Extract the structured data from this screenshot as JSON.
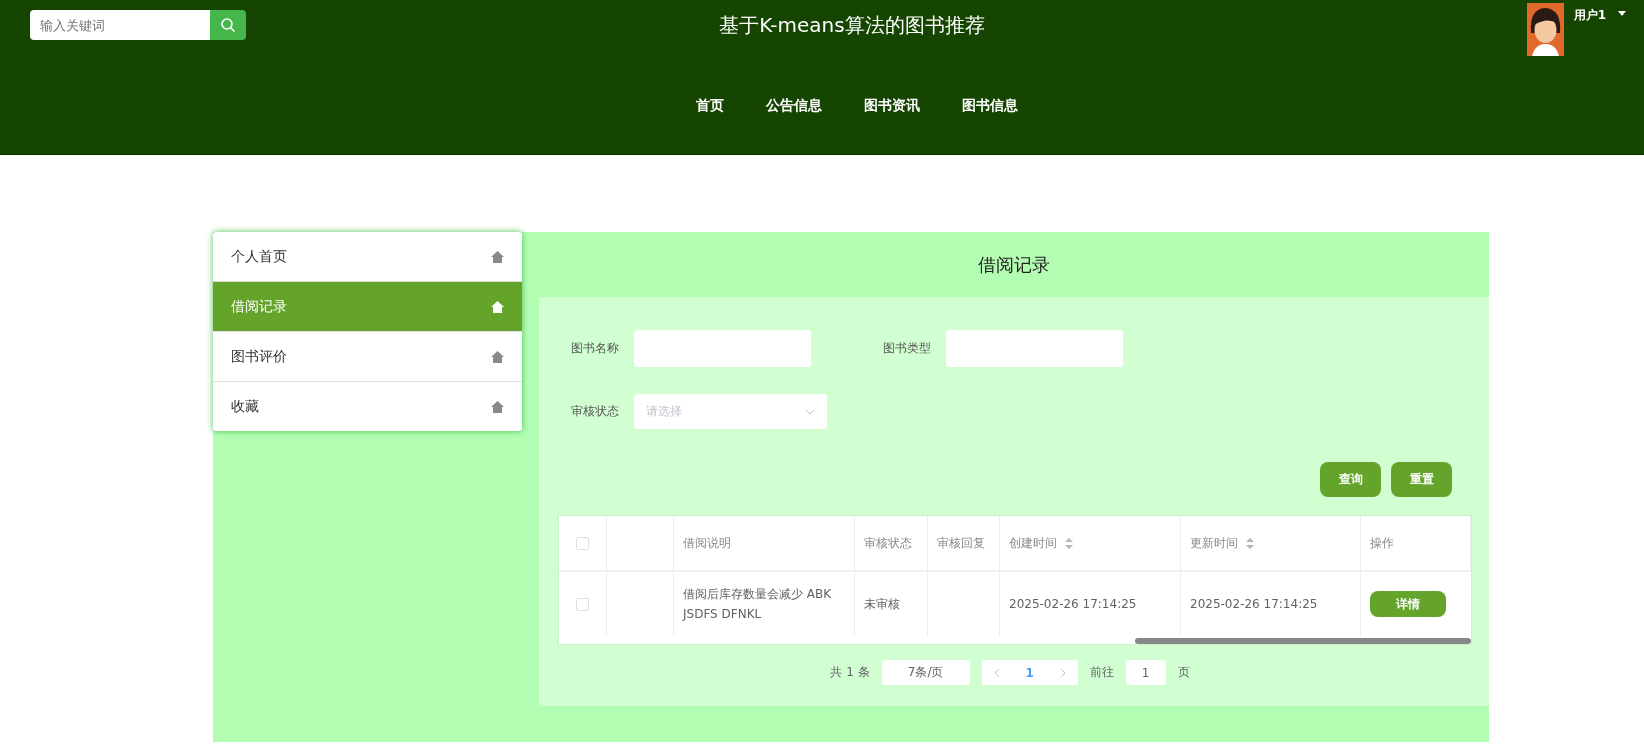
{
  "header": {
    "search": {
      "placeholder": "输入关键词"
    },
    "title": "基于K-means算法的图书推荐",
    "user": {
      "name": "用户1"
    },
    "nav": [
      {
        "label": "首页"
      },
      {
        "label": "公告信息"
      },
      {
        "label": "图书资讯"
      },
      {
        "label": "图书信息"
      }
    ]
  },
  "sidebar": {
    "items": [
      {
        "label": "个人首页",
        "selected": false
      },
      {
        "label": "借阅记录",
        "selected": true
      },
      {
        "label": "图书评价",
        "selected": false
      },
      {
        "label": "收藏",
        "selected": false
      }
    ]
  },
  "panel": {
    "title": "借阅记录",
    "filters": [
      {
        "label": "图书名称",
        "kind": "input"
      },
      {
        "label": "图书类型",
        "kind": "input"
      },
      {
        "label": "审核状态",
        "kind": "select",
        "placeholder": "请选择"
      }
    ],
    "buttons": [
      "查询",
      "重置"
    ],
    "table": {
      "columns": [
        {
          "label": "借阅说明",
          "sortable": false
        },
        {
          "label": "审核状态",
          "sortable": false
        },
        {
          "label": "审核回复",
          "sortable": false
        },
        {
          "label": "创建时间",
          "sortable": true
        },
        {
          "label": "更新时间",
          "sortable": true
        },
        {
          "label": "操作",
          "sortable": false
        }
      ],
      "header_checked": false,
      "rows": [
        {
          "checked": false,
          "cells": [
            "借阅后库存数量会减少 ABK JSDFS DFNKL",
            "未审核",
            "",
            "2025-02-26 17:14:25",
            "2025-02-26 17:14:25"
          ],
          "action": "详情"
        }
      ]
    },
    "pagination": {
      "total": "共 1 条",
      "page_size": "7条/页",
      "pages": [
        {
          "label": "1",
          "selected": true
        }
      ],
      "goto_label": "前往",
      "goto_value": "1",
      "page_suffix": "页"
    }
  }
}
